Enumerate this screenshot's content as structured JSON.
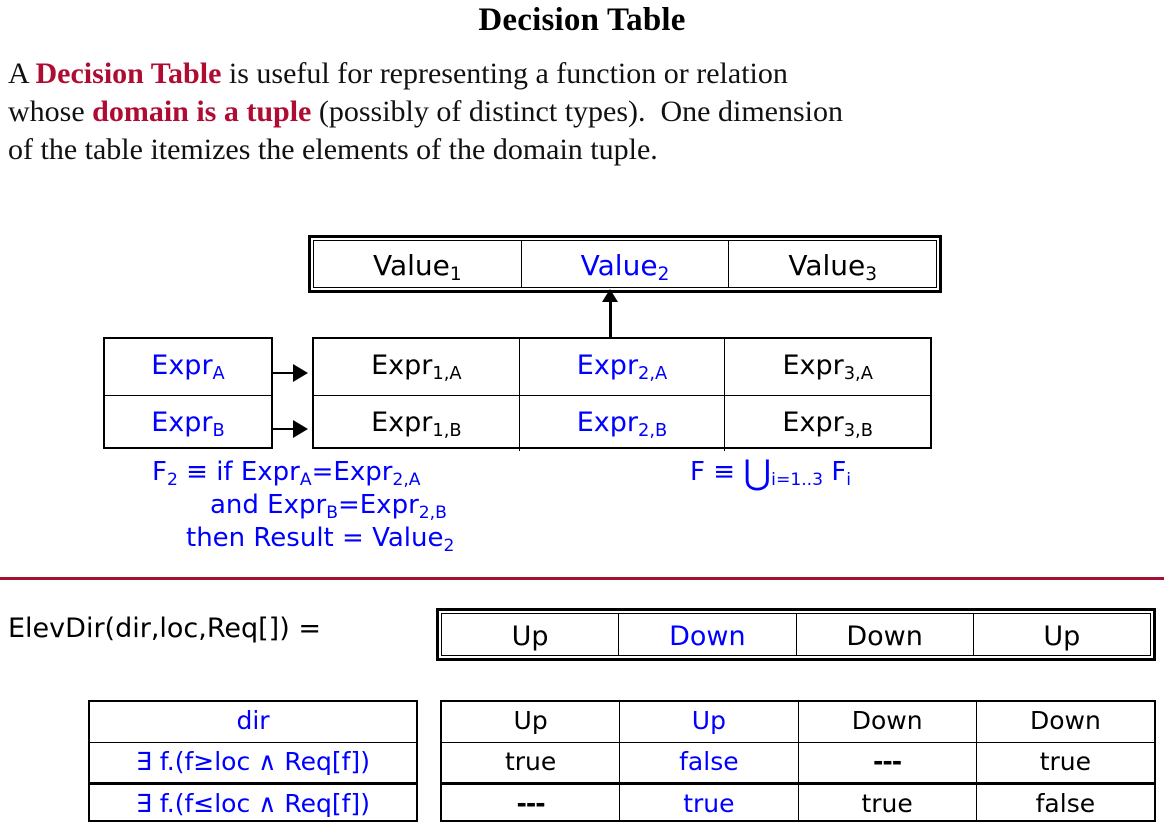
{
  "slide": {
    "title": "Decision Table",
    "intro": {
      "pre": "A ",
      "em1": "Decision Table",
      "mid1": " is useful for representing a function or relation\nwhose ",
      "em2": "domain is a tuple",
      "mid2": " (possibly of distinct types).  One dimension\nof the table itemizes the elements of the domain tuple."
    }
  },
  "colors": {
    "highlight_blue": "#0000FF",
    "emphasis_red": "#AE0C32",
    "divider_red": "#A31133",
    "text_black": "#000000"
  },
  "generic_diagram": {
    "value_row": {
      "name": "value-row",
      "cells": [
        {
          "text": "Value",
          "sub": "1",
          "color": "black"
        },
        {
          "text": "Value",
          "sub": "2",
          "color": "blue"
        },
        {
          "text": "Value",
          "sub": "3",
          "color": "black"
        }
      ]
    },
    "arrow_up": {
      "name": "arrow-up-to-value2",
      "points_to": "Value2"
    },
    "row_labels": [
      {
        "text": "Expr",
        "sub": "A",
        "color": "blue"
      },
      {
        "text": "Expr",
        "sub": "B",
        "color": "blue"
      }
    ],
    "expr_rows": [
      [
        {
          "text": "Expr",
          "sub": "1,A",
          "color": "black"
        },
        {
          "text": "Expr",
          "sub": "2,A",
          "color": "blue"
        },
        {
          "text": "Expr",
          "sub": "3,A",
          "color": "black"
        }
      ],
      [
        {
          "text": "Expr",
          "sub": "1,B",
          "color": "black"
        },
        {
          "text": "Expr",
          "sub": "2,B",
          "color": "blue"
        },
        {
          "text": "Expr",
          "sub": "3,B",
          "color": "black"
        }
      ]
    ],
    "formula_f2": {
      "line1_pre": "F",
      "line1_sub": "2",
      "line1_post": " ≡ if Expr",
      "line1_sub2": "A",
      "line1_tail": "=Expr",
      "line1_sub3": "2,A",
      "line2_pre": "and  Expr",
      "line2_sub": "B",
      "line2_mid": "=Expr",
      "line2_sub2": "2,B",
      "line3_pre": "then Result = Value",
      "line3_sub": "2"
    },
    "formula_f": {
      "pre": "F ≡ ",
      "operator": "⋃",
      "sub": "i=1..3",
      "post": " F",
      "post_sub": "i"
    }
  },
  "elevator_example": {
    "signature": "ElevDir(dir,loc,Req[]) =",
    "result_row": {
      "name": "elevdir-result-row",
      "cells": [
        {
          "text": "Up",
          "color": "black"
        },
        {
          "text": "Down",
          "color": "blue"
        },
        {
          "text": "Down",
          "color": "black"
        },
        {
          "text": "Up",
          "color": "black"
        }
      ]
    },
    "condition_labels": [
      {
        "text": "dir",
        "color": "blue"
      },
      {
        "text": "∃ f.(f≥loc ∧ Req[f])",
        "color": "blue"
      },
      {
        "text": "∃ f.(f≤loc ∧ Req[f])",
        "color": "blue"
      }
    ],
    "condition_rows": [
      [
        {
          "text": "Up",
          "color": "black"
        },
        {
          "text": "Up",
          "color": "blue"
        },
        {
          "text": "Down",
          "color": "black"
        },
        {
          "text": "Down",
          "color": "black"
        }
      ],
      [
        {
          "text": "true",
          "color": "black"
        },
        {
          "text": "false",
          "color": "blue"
        },
        {
          "text": "---",
          "color": "black"
        },
        {
          "text": "true",
          "color": "black"
        }
      ],
      [
        {
          "text": "---",
          "color": "black"
        },
        {
          "text": "true",
          "color": "blue"
        },
        {
          "text": "true",
          "color": "black"
        },
        {
          "text": "false",
          "color": "black"
        }
      ]
    ]
  }
}
